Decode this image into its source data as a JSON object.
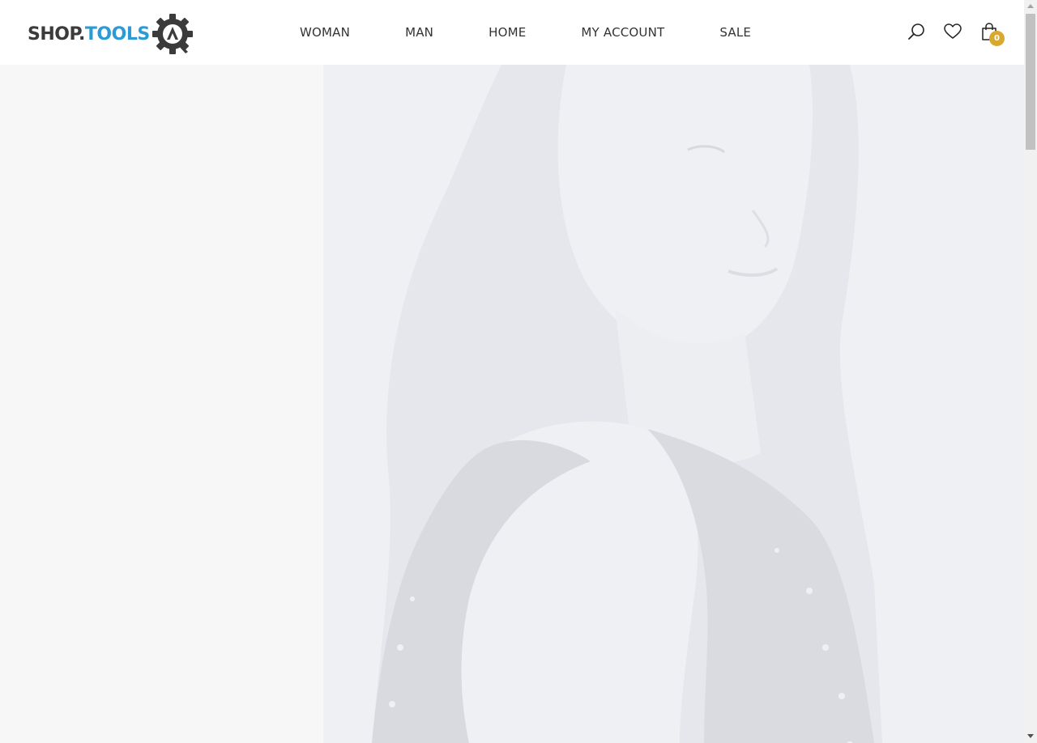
{
  "header": {
    "logo": {
      "part_a": "SHOP.",
      "part_b": "TOOLS",
      "gear_letter": "A"
    },
    "nav": [
      {
        "label": "WOMAN"
      },
      {
        "label": "MAN"
      },
      {
        "label": "HOME"
      },
      {
        "label": "MY ACCOUNT"
      },
      {
        "label": "SALE"
      }
    ],
    "icons": {
      "search": "search-icon",
      "wishlist": "heart-icon",
      "cart": "shopping-bag-icon"
    },
    "cart_count": "0"
  },
  "hero": {
    "image": "woman-portrait-photo"
  },
  "colors": {
    "logo_dark": "#3b3b3b",
    "logo_accent": "#2b9bd6",
    "badge": "#d9a82e",
    "nav_text": "#333333",
    "hero_bg": "#eff0f4",
    "page_bg": "#f7f7f8"
  }
}
